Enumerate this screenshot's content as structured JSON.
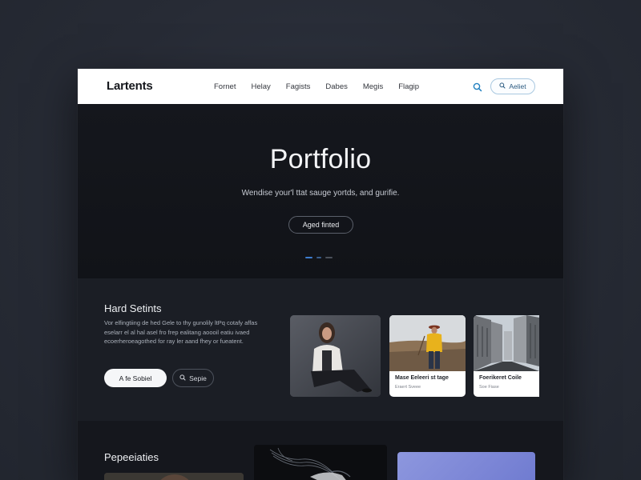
{
  "header": {
    "brand": "Lartents",
    "nav": [
      "Fornet",
      "Helay",
      "Fagists",
      "Dabes",
      "Megis",
      "Flagip"
    ],
    "cta_label": "Aeliet"
  },
  "hero": {
    "title": "Portfolio",
    "subtitle": "Wendise your'l ttat sauge yortds, and gurifie.",
    "button_label": "Aged finted",
    "carousel": {
      "slides": 3,
      "active": 1
    }
  },
  "featured": {
    "title": "Hard Setints",
    "description": "Vor elfingtiing de hed Gele to thy gunolily ltPq cotafy affas eselarr el al hal asel fro frep ealitang aoooil eatiu ivaed ecoerheroeagothed for ray ler aand fhey or fueatent.",
    "primary_button": "A fe Sobiel",
    "secondary_button": "Sepie",
    "cards": [
      {
        "caption": "",
        "meta": ""
      },
      {
        "caption": "Mase Eeleeri st tage",
        "meta": "Eraert Sveee"
      },
      {
        "caption": "Foerikeret Coile",
        "meta": "Soe Fiase"
      }
    ]
  },
  "projects": {
    "title": "Pepeeiaties"
  },
  "colors": {
    "page_bg": "#272b35",
    "window_bg": "#14161c",
    "section_bg": "#1b1e25",
    "accent": "#3d7dcf",
    "nav_bg": "#ffffff"
  }
}
